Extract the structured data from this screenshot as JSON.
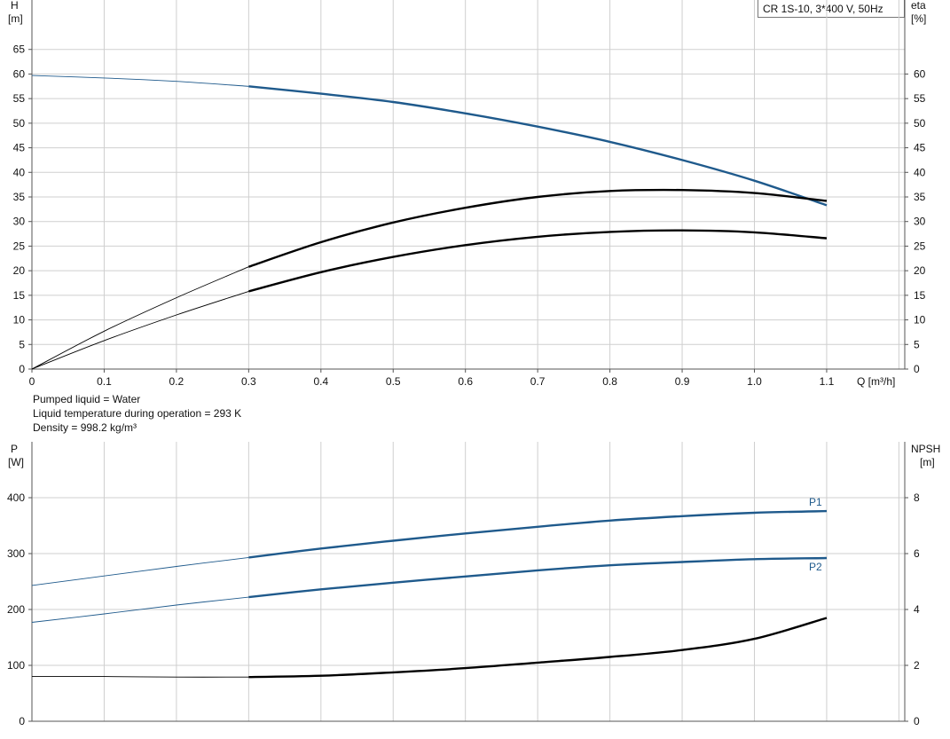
{
  "header": {
    "pump_label": "CR 1S-10, 3*400 V, 50Hz"
  },
  "info": {
    "line1": "Pumped liquid = Water",
    "line2": "Liquid temperature during operation = 293 K",
    "line3": "Density = 998.2 kg/m³"
  },
  "colors": {
    "blue": "#1f5a8c",
    "black": "#000000",
    "grid": "#cfcfcf"
  },
  "chart_data": [
    {
      "type": "line",
      "x_ticks": [
        "0",
        "0.1",
        "0.2",
        "0.3",
        "0.4",
        "0.5",
        "0.6",
        "0.7",
        "0.8",
        "0.9",
        "1.0",
        "1.1"
      ],
      "xlabel": "Q [m³/h]",
      "left_axis": {
        "label_top": "H",
        "label_unit": "[m]",
        "ticks": [
          0,
          5,
          10,
          15,
          20,
          25,
          30,
          35,
          40,
          45,
          50,
          55,
          60,
          65
        ],
        "ylim": [
          0,
          72
        ]
      },
      "right_axis": {
        "label_top": "eta",
        "label_unit": "[%]",
        "ticks": [
          0,
          5,
          10,
          15,
          20,
          25,
          30,
          35,
          40,
          45,
          50,
          55,
          60
        ],
        "ylim": [
          0,
          72
        ]
      },
      "xlim": [
        0,
        1.22
      ],
      "grid": true,
      "series": [
        {
          "axis": "left",
          "color": "#1f5a8c",
          "op_from": 0.3,
          "x": [
            0,
            0.1,
            0.2,
            0.3,
            0.4,
            0.5,
            0.6,
            0.7,
            0.8,
            0.9,
            1.0,
            1.1
          ],
          "y": [
            59.7,
            59.2,
            58.5,
            57.5,
            56.0,
            54.3,
            52.0,
            49.3,
            46.2,
            42.5,
            38.3,
            33.3
          ]
        },
        {
          "axis": "right",
          "color": "#000000",
          "op_from": 0.3,
          "x": [
            0,
            0.1,
            0.2,
            0.3,
            0.4,
            0.5,
            0.6,
            0.7,
            0.8,
            0.9,
            1.0,
            1.1
          ],
          "y": [
            0,
            7.7,
            14.5,
            20.8,
            25.8,
            29.8,
            32.8,
            35.0,
            36.2,
            36.4,
            35.8,
            34.2
          ]
        },
        {
          "axis": "right",
          "color": "#000000",
          "op_from": 0.3,
          "x": [
            0,
            0.1,
            0.2,
            0.3,
            0.4,
            0.5,
            0.6,
            0.7,
            0.8,
            0.9,
            1.0,
            1.1
          ],
          "y": [
            0,
            5.8,
            11.0,
            15.8,
            19.7,
            22.8,
            25.2,
            26.9,
            27.9,
            28.2,
            27.8,
            26.6
          ]
        }
      ]
    },
    {
      "type": "line",
      "x_ticks": [],
      "left_axis": {
        "label_top": "P",
        "label_unit": "[W]",
        "ticks": [
          0,
          100,
          200,
          300,
          400
        ],
        "ylim": [
          0,
          465
        ]
      },
      "right_axis": {
        "label_top": "NPSH",
        "label_unit": "[m]",
        "ticks": [
          0,
          2,
          4,
          6,
          8
        ],
        "ylim": [
          0,
          9.3
        ]
      },
      "xlim": [
        0,
        1.22
      ],
      "grid": true,
      "series": [
        {
          "name": "P1",
          "axis": "left",
          "color": "#1f5a8c",
          "op_from": 0.3,
          "x": [
            0,
            0.1,
            0.2,
            0.3,
            0.4,
            0.5,
            0.6,
            0.7,
            0.8,
            0.9,
            1.0,
            1.1
          ],
          "y": [
            243,
            260,
            277,
            293,
            309,
            323,
            336,
            348,
            359,
            367,
            373,
            376
          ]
        },
        {
          "name": "P2",
          "axis": "left",
          "color": "#1f5a8c",
          "op_from": 0.3,
          "x": [
            0,
            0.1,
            0.2,
            0.3,
            0.4,
            0.5,
            0.6,
            0.7,
            0.8,
            0.9,
            1.0,
            1.1
          ],
          "y": [
            177,
            192,
            208,
            222,
            236,
            248,
            259,
            270,
            279,
            285,
            290,
            292
          ]
        },
        {
          "axis": "right",
          "color": "#000000",
          "op_from": 0.3,
          "x": [
            0,
            0.1,
            0.2,
            0.3,
            0.4,
            0.5,
            0.6,
            0.7,
            0.8,
            0.9,
            1.0,
            1.1
          ],
          "y": [
            1.6,
            1.6,
            1.58,
            1.58,
            1.63,
            1.75,
            1.9,
            2.1,
            2.3,
            2.55,
            2.95,
            3.7
          ]
        }
      ]
    }
  ]
}
